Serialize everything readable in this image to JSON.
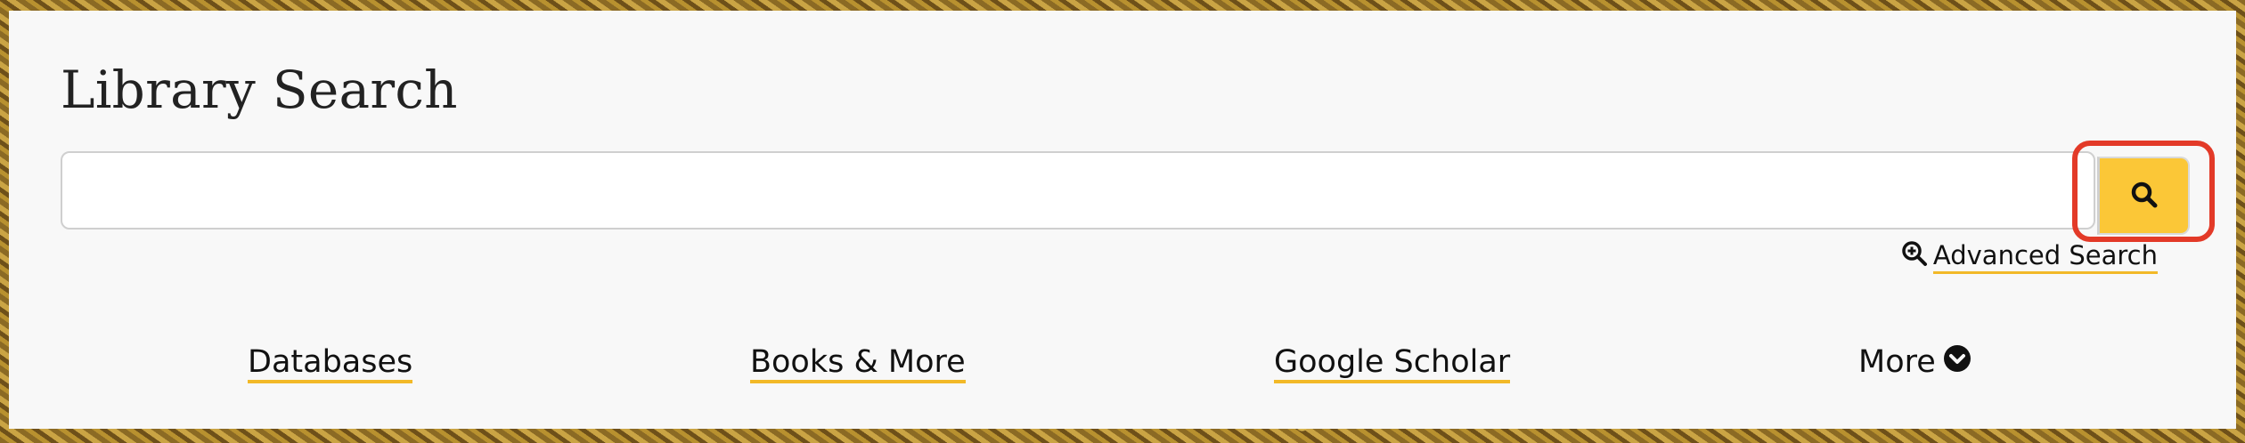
{
  "header": {
    "title": "Library Search"
  },
  "search": {
    "value": "",
    "placeholder": "",
    "button_icon": "search-icon",
    "button_color": "#fbc737",
    "highlight_color": "#e33a28"
  },
  "advanced_search": {
    "icon": "zoom-in-icon",
    "label": "Advanced Search"
  },
  "nav": {
    "items": [
      {
        "label": "Databases"
      },
      {
        "label": "Books & More"
      },
      {
        "label": "Google Scholar"
      },
      {
        "label": "More",
        "icon": "chevron-down-circle-icon"
      }
    ]
  },
  "colors": {
    "accent_underline": "#f2b928",
    "panel_background": "#f8f8f8",
    "text": "#111111"
  }
}
